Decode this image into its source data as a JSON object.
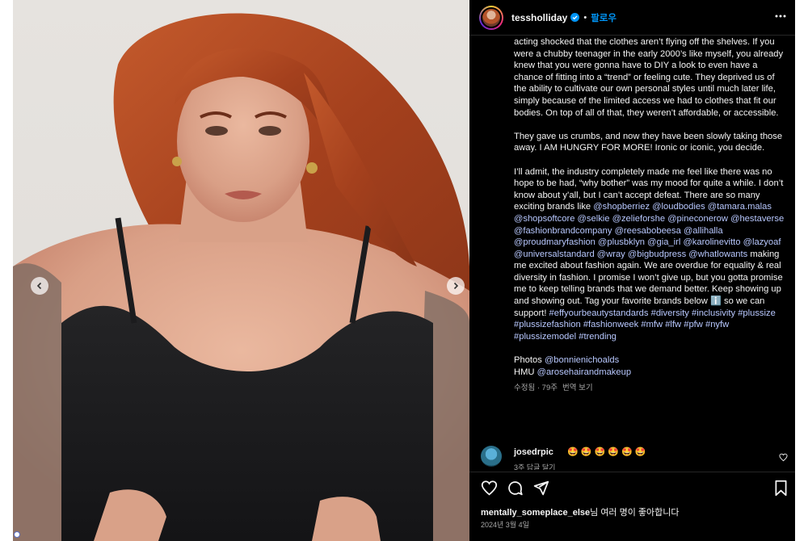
{
  "post": {
    "username": "tessholliday",
    "separator": "•",
    "follow_label": "팔로우"
  },
  "caption": {
    "p1": "acting shocked that the clothes aren’t flying off the shelves. If you were a chubby teenager in the early 2000’s like myself, you already knew that you were gonna have to DIY a look to even have a chance of fitting into a “trend” or feeling cute. They deprived us of the ability to cultivate our own personal styles until much later life, simply because of the limited access we had to clothes that fit our bodies. On top of all of that, they weren’t affordable, or accessible.",
    "p2": "They gave us crumbs, and now they have been slowly taking those away. I AM HUNGRY FOR MORE! Ironic or iconic, you decide.",
    "p3_intro": "I’ll admit, the industry completely made me feel like there was no hope to be had, “why bother” was my mood for quite a while. I don’t know about y’all, but I can’t accept defeat. There are so many exciting brands like",
    "mentions": [
      "@shopberriez",
      "@loudbodies",
      "@tamara.malas",
      "@shopsoftcore",
      "@selkie",
      "@zelieforshe",
      "@pineconerow",
      "@hestaverse",
      "@fashionbrandcompany",
      "@reesabobeesa",
      "@allihalla",
      "@proudmaryfashion",
      "@plusbklyn",
      "@gia_irl",
      "@karolinevitto",
      "@lazyoaf",
      "@universalstandard",
      "@wray",
      "@bigbudpress",
      "@whatlowants"
    ],
    "p3_outro": "making me excited about fashion again. We are overdue for equality & real diversity in fashion. I promise I won’t give up, but you gotta promise me to keep telling brands that we demand better. Keep showing up and showing out. Tag your favorite brands below",
    "emoji_info": "ℹ️",
    "p3_end": "so we can support!",
    "hashtags": [
      "#effyourbeautystandards",
      "#diversity",
      "#inclusivity",
      "#plussize",
      "#plussizefashion",
      "#fashionweek",
      "#mfw",
      "#lfw",
      "#pfw",
      "#nyfw",
      "#plussizemodel",
      "#trending"
    ],
    "photos_label": "Photos",
    "photos_handle": "@bonnienichoalds",
    "hmu_label": "HMU",
    "hmu_handle": "@arosehairandmakeup",
    "edited": "수정됨 · 79주",
    "translate": "번역 보기"
  },
  "comment": {
    "user": "josedrpic",
    "text": "🤩 🤩 🤩 🤩 🤩 🤩",
    "meta": "3주   답글 달기"
  },
  "likes": {
    "user": "mentally_someplace_else",
    "suffix": "님 여러 명이 좋아합니다"
  },
  "date": "2024년 3월 4일",
  "colors": {
    "background": "#000000",
    "link": "#b8c8ff",
    "verified": "#0095f6",
    "follow": "#0095f6",
    "dress": "#1c1c1e",
    "hair": "#b84a22"
  },
  "icons": {
    "verified": "verified-badge-icon",
    "more": "more-horizontal-icon",
    "prev": "chevron-left-icon",
    "next": "chevron-right-icon",
    "heart": "heart-icon",
    "comment": "comment-icon",
    "share": "share-icon",
    "save": "bookmark-icon"
  }
}
